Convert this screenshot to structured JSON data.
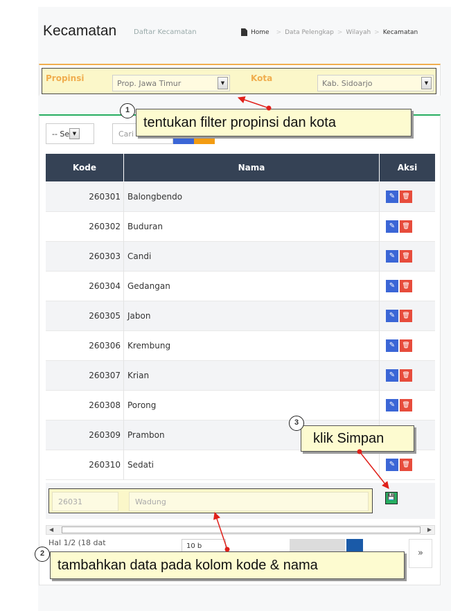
{
  "header": {
    "title": "Kecamatan",
    "subtitle": "Daftar Kecamatan",
    "breadcrumb": {
      "home": "Home",
      "items": [
        "Data Pelengkap",
        "Wilayah",
        "Kecamatan"
      ],
      "separator": ">"
    }
  },
  "filter": {
    "propinsi_label": "Propinsi",
    "propinsi_value": "Prop. Jawa Timur",
    "kota_label": "Kota",
    "kota_value": "Kab. Sidoarjo"
  },
  "toolbar": {
    "rows_select": "-- Se",
    "search_placeholder": "Cari Kecan"
  },
  "table": {
    "columns": [
      "Kode",
      "Nama",
      "Aksi"
    ],
    "rows": [
      {
        "kode": "260301",
        "nama": "Balongbendo"
      },
      {
        "kode": "260302",
        "nama": "Buduran"
      },
      {
        "kode": "260303",
        "nama": "Candi"
      },
      {
        "kode": "260304",
        "nama": "Gedangan"
      },
      {
        "kode": "260305",
        "nama": "Jabon"
      },
      {
        "kode": "260306",
        "nama": "Krembung"
      },
      {
        "kode": "260307",
        "nama": "Krian"
      },
      {
        "kode": "260308",
        "nama": "Porong"
      },
      {
        "kode": "260309",
        "nama": "Prambon"
      },
      {
        "kode": "260310",
        "nama": "Sedati"
      }
    ],
    "new_row": {
      "kode": "26031",
      "nama": "Wadung"
    }
  },
  "pager": {
    "info": "Hal 1/2 (18 dat",
    "size": "10 b",
    "next": "»"
  },
  "annotations": {
    "callout1": {
      "number": "1",
      "text": "tentukan filter propinsi dan kota"
    },
    "callout2": {
      "number": "2",
      "text": "tambahkan data pada kolom kode & nama"
    },
    "callout3": {
      "number": "3",
      "text": "klik Simpan"
    }
  },
  "colors": {
    "header_dark": "#354255",
    "edit_blue": "#3b66d6",
    "delete_red": "#e74c3c",
    "save_green": "#27ae60",
    "callout_bg": "#fdfbd0",
    "arrow_red": "#e0201a"
  }
}
